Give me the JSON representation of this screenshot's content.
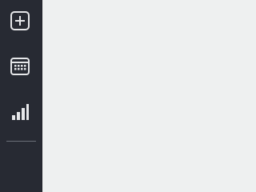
{
  "sidebar": {
    "items": [
      {
        "icon": "add-square-icon"
      },
      {
        "icon": "calendar-icon"
      },
      {
        "icon": "signal-bars-icon"
      }
    ]
  },
  "colors": {
    "sidebar_bg": "#272a33",
    "icon": "#e6e7ea",
    "main_bg": "#eef0f0"
  }
}
